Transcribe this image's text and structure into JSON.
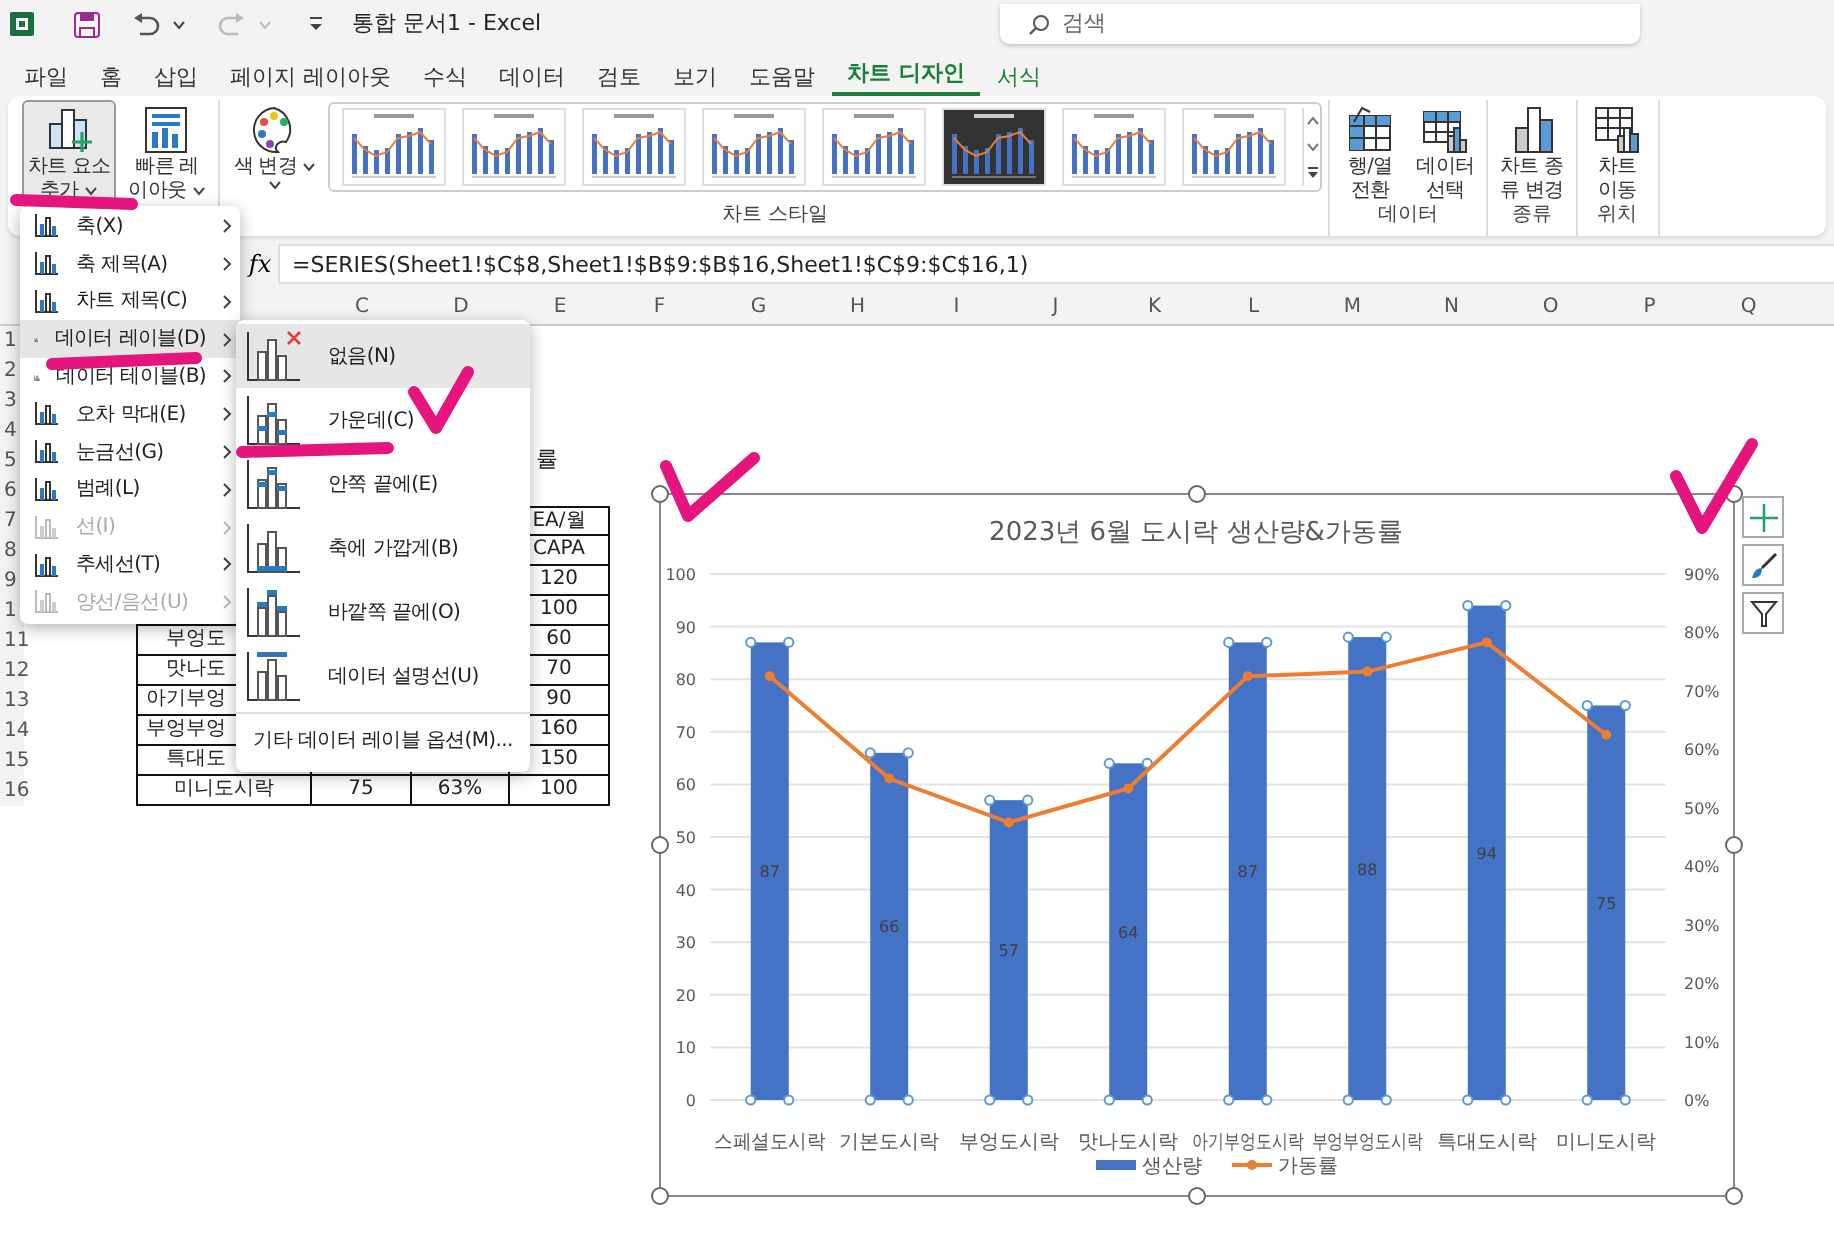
{
  "title_bar": {
    "document_title": "통합 문서1  -  Excel",
    "search": {
      "placeholder": "검색"
    }
  },
  "ribbon_tabs": [
    {
      "label": "파일",
      "selected": false,
      "contextual": false
    },
    {
      "label": "홈",
      "selected": false,
      "contextual": false
    },
    {
      "label": "삽입",
      "selected": false,
      "contextual": false
    },
    {
      "label": "페이지 레이아웃",
      "selected": false,
      "contextual": false
    },
    {
      "label": "수식",
      "selected": false,
      "contextual": false
    },
    {
      "label": "데이터",
      "selected": false,
      "contextual": false
    },
    {
      "label": "검토",
      "selected": false,
      "contextual": false
    },
    {
      "label": "보기",
      "selected": false,
      "contextual": false
    },
    {
      "label": "도움말",
      "selected": false,
      "contextual": false
    },
    {
      "label": "차트 디자인",
      "selected": true,
      "contextual": true
    },
    {
      "label": "서식",
      "selected": false,
      "contextual": true
    }
  ],
  "ribbon": {
    "layout_buttons": [
      {
        "label_lines": [
          "차트 요소",
          "추가"
        ],
        "dropdown": true,
        "pressed": true
      },
      {
        "label_lines": [
          "빠른 레",
          "이아웃"
        ],
        "dropdown": true,
        "pressed": false
      }
    ],
    "styles_group": {
      "label": "차트 스타일",
      "color_button": {
        "label_lines": [
          "색 변경"
        ],
        "dropdown": true,
        "pressed": false
      },
      "thumbnails": [
        {
          "kind": "light"
        },
        {
          "kind": "light"
        },
        {
          "kind": "light"
        },
        {
          "kind": "light"
        },
        {
          "kind": "light"
        },
        {
          "kind": "dark"
        },
        {
          "kind": "light"
        },
        {
          "kind": "light"
        }
      ]
    },
    "groups": [
      {
        "label": "데이터",
        "buttons": [
          {
            "label_lines": [
              "행/열",
              "전환"
            ]
          },
          {
            "label_lines": [
              "데이터",
              "선택"
            ]
          }
        ]
      },
      {
        "label": "종류",
        "buttons": [
          {
            "label_lines": [
              "차트 종",
              "류 변경"
            ]
          }
        ]
      },
      {
        "label": "위치",
        "buttons": [
          {
            "label_lines": [
              "차트",
              "이동"
            ]
          }
        ]
      }
    ]
  },
  "formula_bar": {
    "function_label": "fx",
    "formula": "=SERIES(Sheet1!$C$8,Sheet1!$B$9:$B$16,Sheet1!$C$9:$C$16,1)"
  },
  "sheet": {
    "column_headers": [
      "C",
      "D",
      "E",
      "F",
      "G",
      "H",
      "I",
      "J",
      "K",
      "L",
      "M",
      "N",
      "O",
      "P",
      "Q"
    ],
    "row_headers": [
      "1",
      "2",
      "3",
      "4",
      "5",
      "6",
      "7",
      "8",
      "9",
      "1",
      "11",
      "12",
      "13",
      "14",
      "15",
      "16"
    ],
    "partial_title": "률",
    "table": {
      "rows": [
        [
          null,
          null,
          null,
          "EA/월"
        ],
        [
          null,
          null,
          null,
          "CAPA"
        ],
        [
          null,
          null,
          null,
          "120"
        ],
        [
          null,
          null,
          null,
          "100"
        ],
        [
          "부엉도",
          null,
          null,
          "60"
        ],
        [
          "맛나도",
          null,
          null,
          "70"
        ],
        [
          "아기부엉",
          null,
          null,
          "90"
        ],
        [
          "부엉부엉",
          null,
          null,
          "160"
        ],
        [
          "특대도",
          null,
          null,
          "150"
        ],
        [
          "미니도시락",
          "75",
          "63%",
          "100"
        ]
      ]
    }
  },
  "chart_elements_menu": {
    "items": [
      {
        "label": "축(X)",
        "highlighted": false,
        "disabled": false
      },
      {
        "label": "축 제목(A)",
        "highlighted": false,
        "disabled": false
      },
      {
        "label": "차트 제목(C)",
        "highlighted": false,
        "disabled": false
      },
      {
        "label": "데이터 레이블(D)",
        "highlighted": true,
        "disabled": false
      },
      {
        "label": "데이터 테이블(B)",
        "highlighted": false,
        "disabled": false
      },
      {
        "label": "오차 막대(E)",
        "highlighted": false,
        "disabled": false
      },
      {
        "label": "눈금선(G)",
        "highlighted": false,
        "disabled": false
      },
      {
        "label": "범례(L)",
        "highlighted": false,
        "disabled": false
      },
      {
        "label": "선(I)",
        "highlighted": false,
        "disabled": true
      },
      {
        "label": "추세선(T)",
        "highlighted": false,
        "disabled": false
      },
      {
        "label": "양선/음선(U)",
        "highlighted": false,
        "disabled": true
      }
    ]
  },
  "data_labels_submenu": {
    "items": [
      {
        "label": "없음(N)",
        "highlighted": true
      },
      {
        "label": "가운데(C)",
        "highlighted": false
      },
      {
        "label": "안쪽 끝에(E)",
        "highlighted": false
      },
      {
        "label": "축에 가깝게(B)",
        "highlighted": false
      },
      {
        "label": "바깥쪽 끝에(O)",
        "highlighted": false
      },
      {
        "label": "데이터 설명선(U)",
        "highlighted": false
      }
    ],
    "more_options": "기타 데이터 레이블 옵션(M)..."
  },
  "chart": {
    "selected": true,
    "bar_series_selected": true,
    "chart_data": {
      "type": "bar",
      "title": "2023년 6월 도시락 생산량&가동률",
      "categories": [
        "스페셜도시락",
        "기본도시락",
        "부엉도시락",
        "맛나도시락",
        "아기부엉도시락",
        "부엉부엉도시락",
        "특대도시락",
        "미니도시락"
      ],
      "series": [
        {
          "name": "생산량",
          "color": "#4472c4",
          "values": [
            87,
            66,
            57,
            64,
            87,
            88,
            94,
            75
          ],
          "value_labels": [
            "87",
            "66",
            "57",
            "64",
            "87",
            "88",
            "94",
            "75"
          ]
        },
        {
          "name": "가동률",
          "type": "line",
          "color": "#ed7d31",
          "axis": "y2",
          "marker": "circle",
          "values": [
            72.5,
            55,
            47.5,
            53.3,
            72.5,
            73.3,
            78.3,
            62.5
          ]
        }
      ],
      "ylim": [
        0,
        100
      ],
      "yticks": [
        0,
        10,
        20,
        30,
        40,
        50,
        60,
        70,
        80,
        90,
        100
      ],
      "y2lim": [
        0,
        90
      ],
      "y2ticks": [
        {
          "value": 0,
          "label": "0%"
        },
        {
          "value": 10,
          "label": "10%"
        },
        {
          "value": 20,
          "label": "20%"
        },
        {
          "value": 30,
          "label": "30%"
        },
        {
          "value": 40,
          "label": "40%"
        },
        {
          "value": 50,
          "label": "50%"
        },
        {
          "value": 60,
          "label": "60%"
        },
        {
          "value": 70,
          "label": "70%"
        },
        {
          "value": 80,
          "label": "80%"
        },
        {
          "value": 90,
          "label": "90%"
        }
      ],
      "grid": true,
      "legend": "bottom"
    }
  }
}
